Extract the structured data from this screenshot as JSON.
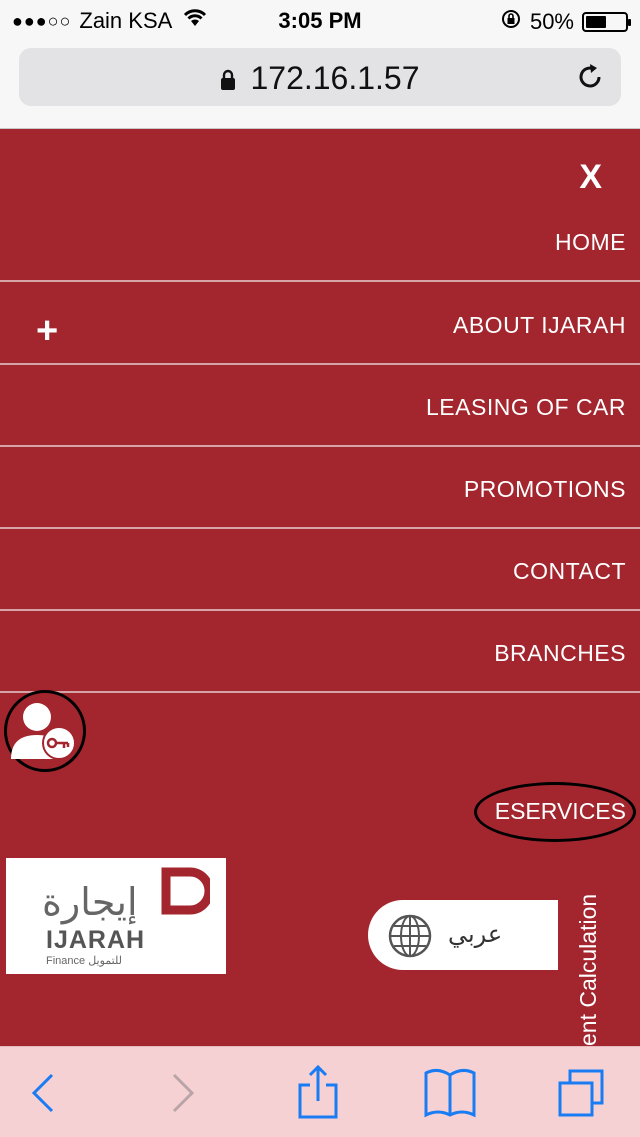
{
  "status": {
    "carrier": "Zain KSA",
    "time": "3:05 PM",
    "battery": "50%",
    "signal_dots": "●●●○○",
    "battery_level": 0.5
  },
  "browser": {
    "url": "172.16.1.57"
  },
  "menu": {
    "close_label": "X",
    "items": [
      {
        "label": "HOME"
      },
      {
        "label": "ABOUT IJARAH"
      },
      {
        "label": "LEASING OF CAR"
      },
      {
        "label": "PROMOTIONS"
      },
      {
        "label": "CONTACT"
      },
      {
        "label": "BRANCHES"
      }
    ],
    "expand_label": "+",
    "eservices_label": "ESERVICES"
  },
  "logo": {
    "arabic": "إيجارة",
    "english": "IJARAH",
    "finance": "Finance للتمويل"
  },
  "language": {
    "label": "عربي"
  },
  "side_tab": {
    "label": "ent Calculation"
  },
  "colors": {
    "primary": "#a3262e",
    "toolbar": "#f6d1d4",
    "ios_blue": "#1a7cf2"
  }
}
